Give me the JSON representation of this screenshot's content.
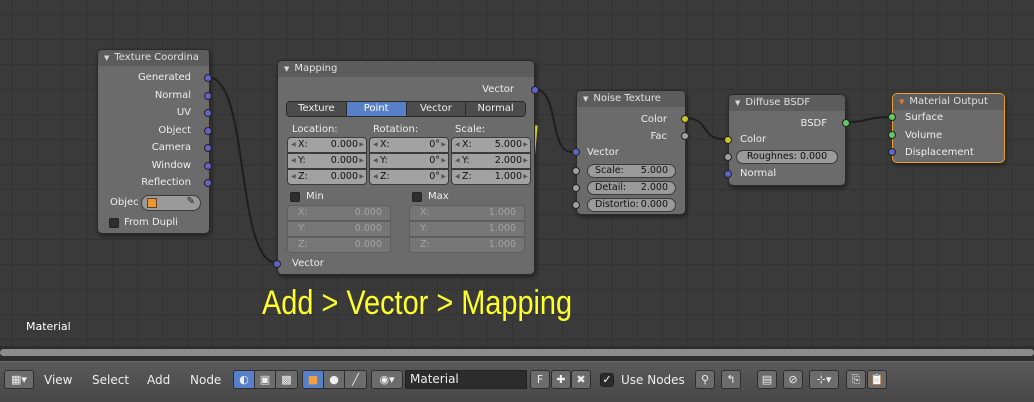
{
  "nodes": {
    "texcoord": {
      "title": "Texture Coordina",
      "outputs": [
        "Generated",
        "Normal",
        "UV",
        "Object",
        "Camera",
        "Window",
        "Reflection"
      ],
      "object_label": "Objec",
      "from_dupli": "From Dupli"
    },
    "mapping": {
      "title": "Mapping",
      "output": "Vector",
      "tabs": [
        "Texture",
        "Point",
        "Vector",
        "Normal"
      ],
      "active_tab": "Point",
      "location_label": "Location:",
      "rotation_label": "Rotation:",
      "scale_label": "Scale:",
      "location": [
        [
          "X:",
          "0.000"
        ],
        [
          "Y:",
          "0.000"
        ],
        [
          "Z:",
          "0.000"
        ]
      ],
      "rotation": [
        [
          "X:",
          "0°"
        ],
        [
          "Y:",
          "0°"
        ],
        [
          "Z:",
          "0°"
        ]
      ],
      "scale": [
        [
          "X:",
          "5.000"
        ],
        [
          "Y:",
          "2.000"
        ],
        [
          "Z:",
          "1.000"
        ]
      ],
      "min_label": "Min",
      "max_label": "Max",
      "min": [
        [
          "X:",
          "0.000"
        ],
        [
          "Y:",
          "0.000"
        ],
        [
          "Z:",
          "0.000"
        ]
      ],
      "max": [
        [
          "X:",
          "1.000"
        ],
        [
          "Y:",
          "1.000"
        ],
        [
          "Z:",
          "1.000"
        ]
      ],
      "input": "Vector"
    },
    "noise": {
      "title": "Noise Texture",
      "outputs": [
        "Color",
        "Fac"
      ],
      "input_vector": "Vector",
      "fields": [
        [
          "Scale:",
          "5.000"
        ],
        [
          "Detail:",
          "2.000"
        ],
        [
          "Distortio:",
          "0.000"
        ]
      ]
    },
    "diffuse": {
      "title": "Diffuse BSDF",
      "output": "BSDF",
      "input_color": "Color",
      "roughness": "Roughnes: 0.000",
      "input_normal": "Normal"
    },
    "output": {
      "title": "Material Output",
      "inputs": [
        "Surface",
        "Volume",
        "Displacement"
      ]
    }
  },
  "annotation": "Add > Vector > Mapping",
  "editor_label": "Material",
  "header": {
    "menus": [
      "View",
      "Select",
      "Add",
      "Node"
    ],
    "material_name": "Material",
    "fake_user": "F",
    "use_nodes_label": "Use Nodes",
    "use_nodes_checked": "✓"
  },
  "colors": {
    "vector_socket": "#6363c7",
    "color_socket": "#c7c729",
    "float_socket": "#a1a1a1",
    "shader_socket": "#63c763",
    "active_tab": "#5780c8",
    "annotation": "#ffff2a",
    "active_node_border": "#e8a032"
  }
}
